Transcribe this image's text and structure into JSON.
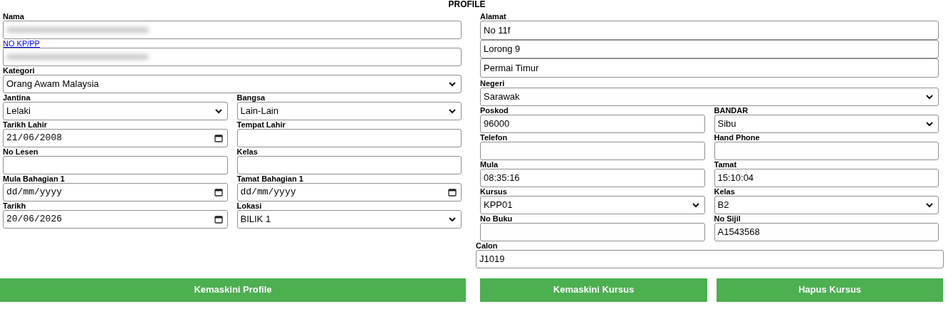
{
  "title": "PROFILE",
  "left": {
    "full": [
      {
        "label": "Nama",
        "kind": "redacted",
        "label_link": false
      },
      {
        "label": "NO KP/PP",
        "kind": "redacted",
        "label_link": true
      },
      {
        "label": "Kategori",
        "kind": "select",
        "value": "Orang Awam Malaysia",
        "label_link": false
      }
    ],
    "grid": [
      {
        "label": "Jantina",
        "kind": "select",
        "value": "Lelaki"
      },
      {
        "label": "Bangsa",
        "kind": "select",
        "value": "Lain-Lain"
      },
      {
        "label": "Tarikh Lahir",
        "kind": "date",
        "value": "21/06/2008"
      },
      {
        "label": "Tempat Lahir",
        "kind": "text"
      },
      {
        "label": "No Lesen",
        "kind": "text"
      },
      {
        "label": "Kelas",
        "kind": "text"
      },
      {
        "label": "Mula Bahagian 1",
        "kind": "date",
        "placeholder": "dd/mm/yyyy"
      },
      {
        "label": "Tamat Bahagian 1",
        "kind": "date",
        "placeholder": "dd/mm/yyyy"
      },
      {
        "label": "Tarikh",
        "kind": "date",
        "value": "20/06/2026"
      },
      {
        "label": "Lokasi",
        "kind": "select",
        "value": "BILIK 1"
      }
    ]
  },
  "right": {
    "address": {
      "label": "Alamat",
      "lines": [
        "No 11f",
        "Lorong 9",
        "Permai Timur"
      ]
    },
    "state": {
      "label": "Negeri",
      "kind": "select",
      "value": "Sarawak"
    },
    "grid": [
      {
        "label": "Poskod",
        "kind": "text",
        "value": "96000"
      },
      {
        "label": "BANDAR",
        "kind": "select",
        "value": "Sibu"
      },
      {
        "label": "Telefon",
        "kind": "text"
      },
      {
        "label": "Hand Phone",
        "kind": "text"
      },
      {
        "label": "Mula",
        "kind": "text",
        "value": "08:35:16"
      },
      {
        "label": "Tamat",
        "kind": "text",
        "value": "15:10:04"
      },
      {
        "label": "Kursus",
        "kind": "select",
        "value": "KPP01"
      },
      {
        "label": "Kelas",
        "kind": "select",
        "value": "B2"
      },
      {
        "label": "No Buku",
        "kind": "text"
      },
      {
        "label": "No Sijil",
        "kind": "text",
        "value": "A1543568"
      }
    ],
    "candidate": {
      "label": "Calon",
      "kind": "text",
      "value": "J1019"
    }
  },
  "buttons": [
    "Kemaskini Profile",
    "Kemaskini Kursus",
    "Hapus Kursus"
  ]
}
